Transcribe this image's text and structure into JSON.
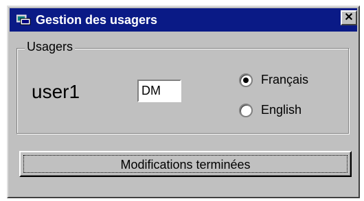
{
  "window": {
    "title": "Gestion des usagers",
    "close_glyph": "✕",
    "icon": "app-icon"
  },
  "group": {
    "label": "Usagers",
    "user_name": "user1",
    "initials_value": "DM"
  },
  "language": {
    "options": [
      {
        "label": "Français",
        "selected": true
      },
      {
        "label": "English",
        "selected": false
      }
    ]
  },
  "actions": {
    "done_label": "Modifications terminées"
  },
  "colors": {
    "titlebar": "#0a1a86",
    "face": "#c0c0c0"
  }
}
